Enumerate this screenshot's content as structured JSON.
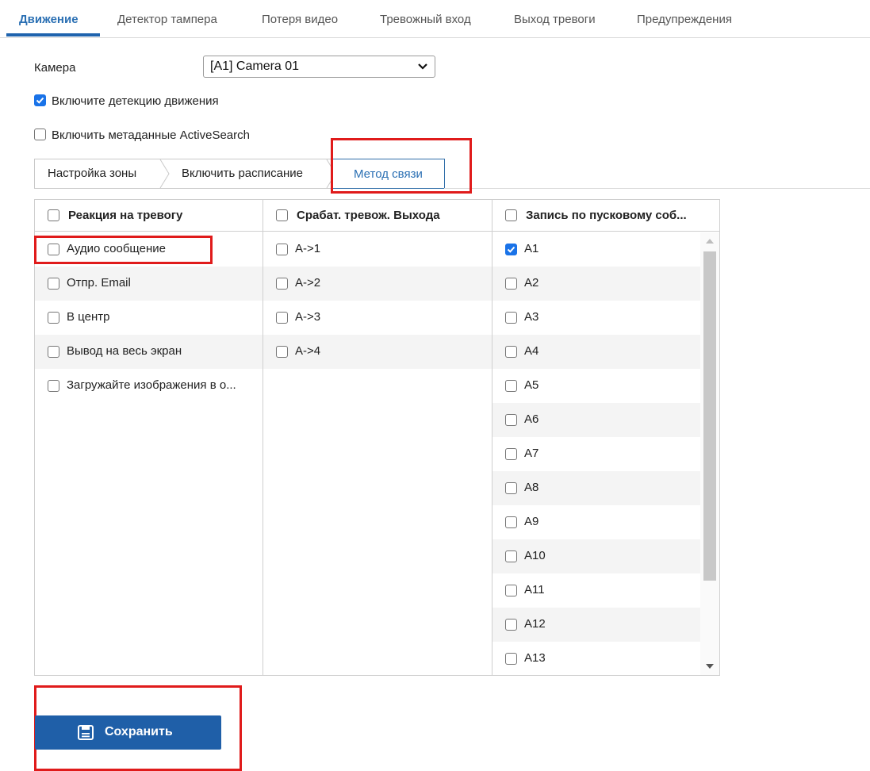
{
  "tabs": [
    {
      "label": "Движение"
    },
    {
      "label": "Детектор тампера"
    },
    {
      "label": "Потеря видео"
    },
    {
      "label": "Тревожный вход"
    },
    {
      "label": "Выход тревоги"
    },
    {
      "label": "Предупреждения"
    }
  ],
  "active_tab": "Движение",
  "camera": {
    "label": "Камера",
    "selected": "[A1] Camera 01"
  },
  "options": {
    "motion_detection": {
      "label": "Включите детекцию движения",
      "checked": true
    },
    "activesearch": {
      "label": "Включить метаданные ActiveSearch",
      "checked": false
    }
  },
  "steps": [
    {
      "label": "Настройка зоны"
    },
    {
      "label": "Включить расписание"
    },
    {
      "label": "Метод связи"
    }
  ],
  "columns": [
    {
      "header": "Реакция на тревогу",
      "items": [
        {
          "label": "Аудио сообщение",
          "checked": false
        },
        {
          "label": "Отпр. Email",
          "checked": false
        },
        {
          "label": "В центр",
          "checked": false
        },
        {
          "label": "Вывод на весь экран",
          "checked": false
        },
        {
          "label": "Загружайте изображения в о...",
          "checked": false
        }
      ]
    },
    {
      "header": "Срабат. тревож. Выхода",
      "items": [
        {
          "label": "A->1",
          "checked": false
        },
        {
          "label": "A->2",
          "checked": false
        },
        {
          "label": "A->3",
          "checked": false
        },
        {
          "label": "A->4",
          "checked": false
        }
      ]
    },
    {
      "header": "Запись по пусковому соб...",
      "items": [
        {
          "label": "A1",
          "checked": true
        },
        {
          "label": "A2",
          "checked": false
        },
        {
          "label": "A3",
          "checked": false
        },
        {
          "label": "A4",
          "checked": false
        },
        {
          "label": "A5",
          "checked": false
        },
        {
          "label": "A6",
          "checked": false
        },
        {
          "label": "A7",
          "checked": false
        },
        {
          "label": "A8",
          "checked": false
        },
        {
          "label": "A9",
          "checked": false
        },
        {
          "label": "A10",
          "checked": false
        },
        {
          "label": "A11",
          "checked": false
        },
        {
          "label": "A12",
          "checked": false
        },
        {
          "label": "A13",
          "checked": false
        }
      ]
    }
  ],
  "save_button": {
    "label": "Сохранить"
  },
  "colors": {
    "accent": "#1f5fa8",
    "highlight": "#e01b1b",
    "checkbox": "#1a73e8"
  }
}
